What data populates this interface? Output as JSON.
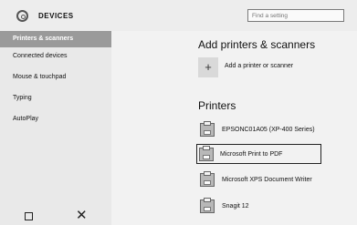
{
  "header": {
    "title": "DEVICES",
    "search_placeholder": "Find a setting"
  },
  "sidebar": {
    "items": [
      {
        "label": "Printers & scanners",
        "active": true
      },
      {
        "label": "Connected devices",
        "active": false
      },
      {
        "label": "Mouse & touchpad",
        "active": false
      },
      {
        "label": "Typing",
        "active": false
      },
      {
        "label": "AutoPlay",
        "active": false
      }
    ]
  },
  "main": {
    "add_heading": "Add printers & scanners",
    "add_label": "Add a printer or scanner",
    "printers_heading": "Printers",
    "printers": [
      {
        "name": "EPSONC01A05 (XP-400 Series)"
      },
      {
        "name": "Microsoft Print to PDF",
        "selected": true
      },
      {
        "name": "Microsoft XPS Document Writer"
      },
      {
        "name": "Snagit 12"
      }
    ]
  },
  "icons": {
    "settings": "gear-icon",
    "add": "plus-icon",
    "printer": "printer-icon",
    "minimize": "minimize-icon",
    "close": "close-icon"
  }
}
